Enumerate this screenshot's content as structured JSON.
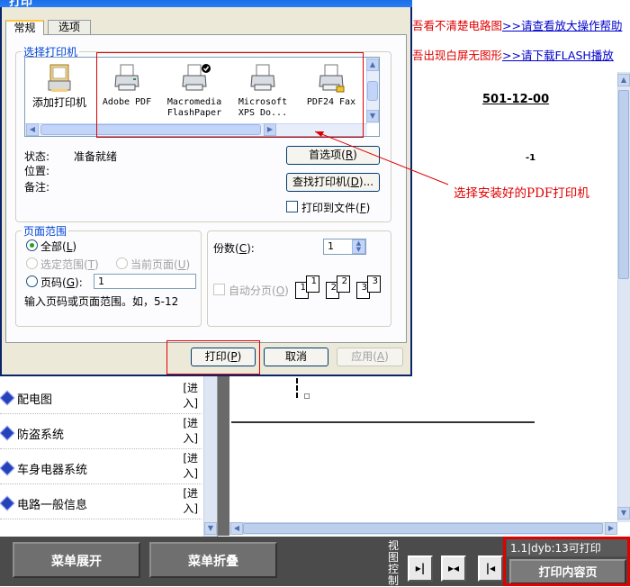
{
  "background": {
    "hint1_red": "吾看不清楚电路图",
    "hint1_link": ">>请查看放大操作帮助",
    "hint2_red": "吾出现白屏无图形",
    "hint2_link": ">>请下载FLASH播放",
    "doc_code": "501-12-00",
    "doc_mark": "-1",
    "menu_items": [
      {
        "label": "配电图",
        "enter": "[进入]"
      },
      {
        "label": "防盗系统",
        "enter": "[进入]"
      },
      {
        "label": "车身电器系统",
        "enter": "[进入]"
      },
      {
        "label": "电路一般信息",
        "enter": "[进入]"
      }
    ]
  },
  "bottom_bar": {
    "expand_label": "菜单展开",
    "collapse_label": "菜单折叠",
    "view_control_label": "视图控制",
    "status": "1.1|dyb:13可打印",
    "print_content_label": "打印内容页"
  },
  "dialog": {
    "title": "打印",
    "tabs": [
      "常规",
      "选项"
    ],
    "select_printer_title": "选择打印机",
    "printers": [
      {
        "name": "添加打印机",
        "icon": "add-printer-icon"
      },
      {
        "name": "Adobe PDF",
        "icon": "printer-icon"
      },
      {
        "name": "Macromedia FlashPaper",
        "line1": "Macromedia",
        "line2": "FlashPaper",
        "icon": "printer-default-icon"
      },
      {
        "name": "Microsoft XPS Do...",
        "line1": "Microsoft",
        "line2": "XPS Do...",
        "icon": "printer-icon"
      },
      {
        "name": "PDF24 Fax",
        "icon": "fax-printer-icon"
      }
    ],
    "status_label": "状态:",
    "status_value": "准备就绪",
    "location_label": "位置:",
    "comment_label": "备注:",
    "preferences_btn": "首选项",
    "preferences_key": "R",
    "find_printer_btn": "查找打印机",
    "find_printer_key": "D",
    "print_to_file_label": "打印到文件",
    "print_to_file_key": "F",
    "page_range_title": "页面范围",
    "all_label": "全部",
    "all_key": "L",
    "selection_label": "选定范围",
    "selection_key": "T",
    "current_page_label": "当前页面",
    "current_page_key": "U",
    "pages_label": "页码",
    "pages_key": "G",
    "pages_value": "1",
    "pages_hint": "输入页码或页面范围。如，5-12",
    "copies_label": "份数",
    "copies_key": "C",
    "copies_value": "1",
    "collate_label": "自动分页",
    "collate_key": "O",
    "print_btn": "打印",
    "print_key": "P",
    "cancel_btn": "取消",
    "apply_btn": "应用",
    "apply_key": "A"
  },
  "annotation": {
    "text": "选择安装好的PDF打印机",
    "color": "#e00000"
  }
}
